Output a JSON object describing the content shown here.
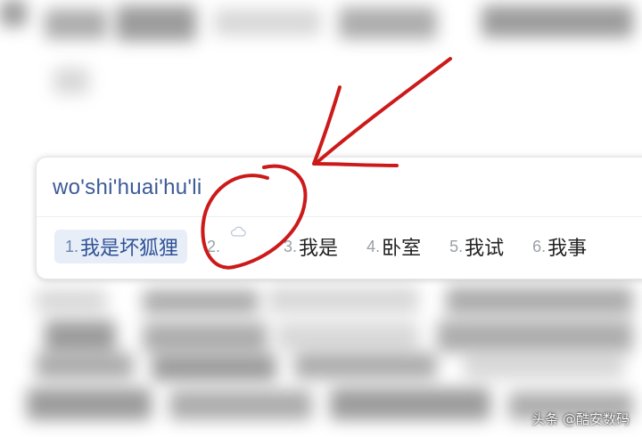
{
  "ime": {
    "pinyin": "wo'shi'huai'hu'li",
    "candidates": [
      {
        "num": "1.",
        "text": "我是坏狐狸"
      },
      {
        "num": "2.",
        "text": ""
      },
      {
        "num": "3.",
        "text": "我是"
      },
      {
        "num": "4.",
        "text": "卧室"
      },
      {
        "num": "5.",
        "text": "我试"
      },
      {
        "num": "6.",
        "text": "我事"
      }
    ],
    "cloud_icon": "cloud-icon"
  },
  "annotation": {
    "color": "#cc1a1a"
  },
  "watermark": "头条 @酷安数码"
}
